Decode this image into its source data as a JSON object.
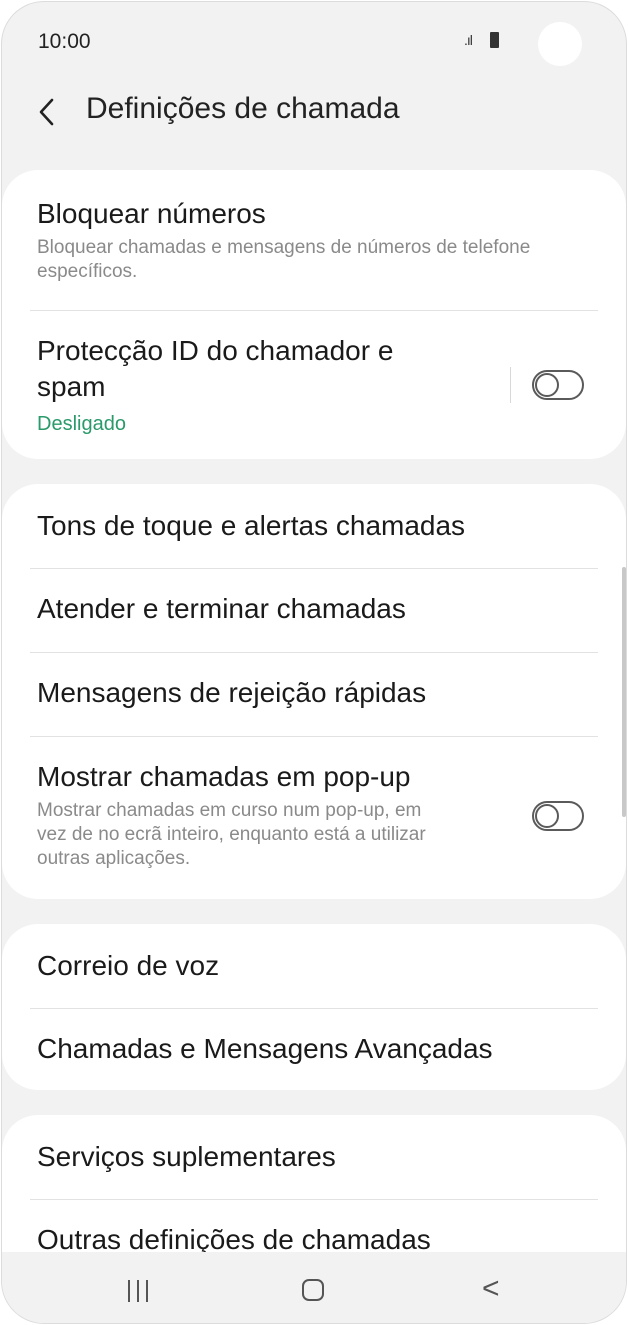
{
  "status_bar": {
    "time": "10:00",
    "signal": ".ıl",
    "icons": [
      "signal-icon",
      "battery-icon"
    ]
  },
  "header": {
    "back_icon": "chevron-left-icon",
    "title": "Definições de chamada"
  },
  "card1": {
    "block_numbers": {
      "title": "Bloquear números",
      "subtitle": "Bloquear chamadas e mensagens de números de telefone específicos."
    },
    "caller_id": {
      "title_line1": "Protecção ID do chamador e",
      "title_line2": "spam",
      "status": "Desligado",
      "status_color": "#2a9a6a",
      "toggle": false
    }
  },
  "card2": {
    "items": [
      {
        "label": "Tons de toque e alertas chamadas"
      },
      {
        "label": "Atender e terminar chamadas"
      },
      {
        "label": "Mensagens de rejeição rápidas"
      }
    ],
    "popup": {
      "title": "Mostrar chamadas em pop-up",
      "sub_line1": "Mostrar chamadas em curso num pop-up, em",
      "sub_line2": "vez de no ecrã inteiro, enquanto está a utilizar",
      "sub_line3": "outras aplicações.",
      "toggle": false
    }
  },
  "card3": {
    "items": [
      {
        "label": "Correio de voz"
      },
      {
        "label": "Chamadas e Mensagens Avançadas"
      }
    ]
  },
  "card4": {
    "items": [
      {
        "label": "Serviços suplementares"
      },
      {
        "label": "Outras definições de chamadas"
      }
    ]
  },
  "navbar": {
    "icons": [
      "recent-apps-icon",
      "home-icon",
      "back-icon"
    ],
    "back_glyph": "<"
  }
}
